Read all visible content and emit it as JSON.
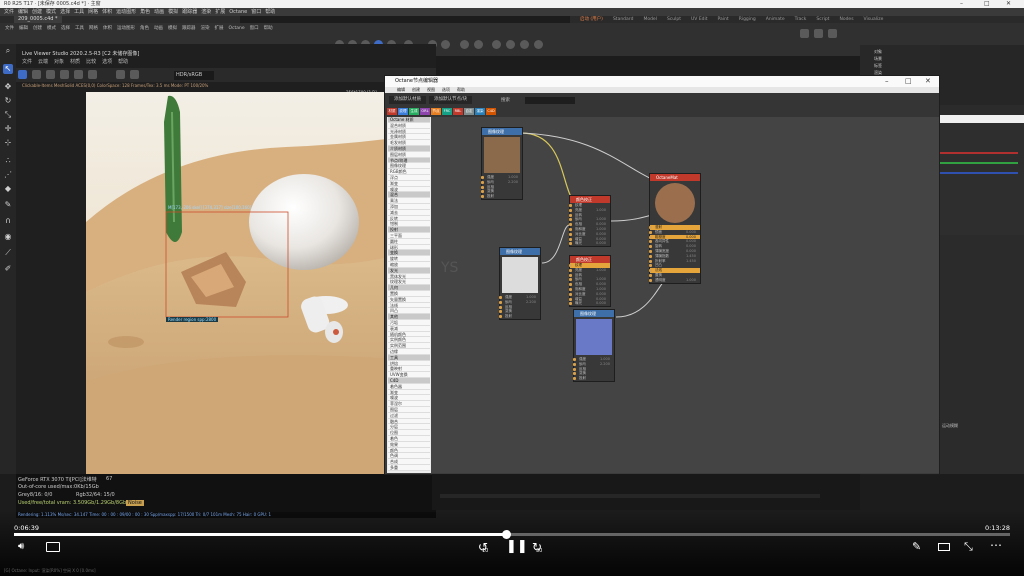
{
  "window": {
    "title": "R0 R25 T17 · [未保存 0005.c4d *] · 主窗",
    "file_tab": "209_0005.c4d *"
  },
  "menubar": [
    "文件",
    "编辑",
    "创建",
    "模式",
    "选择",
    "工具",
    "网格",
    "体积",
    "运动图形",
    "角色",
    "动画",
    "模拟",
    "跟踪器",
    "渲染",
    "扩展",
    "Octane",
    "窗口",
    "帮助"
  ],
  "layouts": [
    {
      "label": "启动 (用户)",
      "active": true
    },
    {
      "label": "Standard"
    },
    {
      "label": "Model"
    },
    {
      "label": "Sculpt"
    },
    {
      "label": "UV Edit"
    },
    {
      "label": "Paint"
    },
    {
      "label": "Rigging"
    },
    {
      "label": "Animate"
    },
    {
      "label": "Track"
    },
    {
      "label": "Script"
    },
    {
      "label": "Nodes"
    },
    {
      "label": "Visualize"
    }
  ],
  "live_viewer": {
    "title": "Live Viewer Studio 2020.2.5-R3   [C2 未储存图像]",
    "menu": [
      "文件",
      "云端",
      "对象",
      "材质",
      "比较",
      "选项",
      "帮助"
    ],
    "resolution": "HDR/sRGB",
    "info": "Clickable-Items  MeshSolid  ACES(0,0) ColorSpace: 128 Frames/Tex: 3.5 ms  Mode:  PT 100/20%",
    "fps_label": "256*1700 [1/2]",
    "region_label": "Render region spp:2800",
    "pick_label": "M[173,-206 skel] [374,317] size[100,160]"
  },
  "render_stats": {
    "gpu": "GeForce RTX 3070 Ti[PCI]法维特",
    "gpu_temp": "67",
    "line2": "Out-of-core used/max:0Kb/15Gb",
    "line3a": "Grey8/16: 0/0",
    "line3b": "Rgb32/64: 15/0",
    "line4": "Used/free/total vram: 3.509Gb/1.29Gb/8Gb",
    "noise": "Noise",
    "progress": "Rendering: 1.113%  Ms/sec: 34.147  Time: 00 : 00 : 09/00 : 00 : 30  Spp/maxspp: 17/1500  Tri: 0/7 101m  Mesh: 75  Hair: 0  GPU: 1"
  },
  "node_editor": {
    "title": "Octane节点编辑器",
    "menu": [
      "编辑",
      "创建",
      "视图",
      "选项",
      "帮助"
    ],
    "buttons": [
      "添加默认材质",
      "添加默认节点/块"
    ],
    "search_label": "搜索",
    "tags": [
      "材质",
      "纹理",
      "生成",
      "ORL",
      "节点",
      "FRC",
      "RBL",
      "自定",
      "渲染",
      "C4D"
    ],
    "node_list": [
      {
        "label": "Octane 材质",
        "hdr": true
      },
      {
        "label": "混合材质"
      },
      {
        "label": "光泽材质"
      },
      {
        "label": "金属材质"
      },
      {
        "label": "毛发材质"
      },
      {
        "label": "介质材质",
        "hdr": true
      },
      {
        "label": "图层材质"
      },
      {
        "label": "节点/纹理",
        "hdr": true
      },
      {
        "label": "图像纹理"
      },
      {
        "label": "RGB颜色"
      },
      {
        "label": "浮点"
      },
      {
        "label": "渐变"
      },
      {
        "label": "噪波"
      },
      {
        "label": "混合",
        "hdr": true
      },
      {
        "label": "乘法"
      },
      {
        "label": "添加"
      },
      {
        "label": "减去"
      },
      {
        "label": "反转"
      },
      {
        "label": "钳制"
      },
      {
        "label": "投射",
        "hdr": true
      },
      {
        "label": "三平面"
      },
      {
        "label": "圆柱"
      },
      {
        "label": "球形"
      },
      {
        "label": "变换",
        "hdr": true
      },
      {
        "label": "旋转"
      },
      {
        "label": "缩放"
      },
      {
        "label": "发光",
        "hdr": true
      },
      {
        "label": "黑体发光"
      },
      {
        "label": "纹理发光"
      },
      {
        "label": "几何",
        "hdr": true
      },
      {
        "label": "置换"
      },
      {
        "label": "矢量置换"
      },
      {
        "label": "法线"
      },
      {
        "label": "凹凸"
      },
      {
        "label": "其他",
        "hdr": true
      },
      {
        "label": "污垢"
      },
      {
        "label": "衰减"
      },
      {
        "label": "随机颜色"
      },
      {
        "label": "实例颜色"
      },
      {
        "label": "实例范围"
      },
      {
        "label": "边缘"
      },
      {
        "label": "工具",
        "hdr": true
      },
      {
        "label": "烘焙"
      },
      {
        "label": "重映射"
      },
      {
        "label": "UVW变换"
      },
      {
        "label": "C4D",
        "hdr": true
      },
      {
        "label": "着色器"
      },
      {
        "label": "渐变"
      },
      {
        "label": "噪波"
      },
      {
        "label": "菲涅尔"
      },
      {
        "label": "图层"
      },
      {
        "label": "过滤"
      },
      {
        "label": "融合"
      },
      {
        "label": "分层"
      },
      {
        "label": "位图"
      },
      {
        "label": "着色"
      },
      {
        "label": "效果"
      },
      {
        "label": "颜色"
      },
      {
        "label": "色调"
      },
      {
        "label": "合成"
      },
      {
        "label": "多重"
      }
    ],
    "nodes": {
      "tex1": {
        "title": "图像纹理",
        "ports": [
          {
            "l": "强度",
            "v": "1.000"
          },
          {
            "l": "伽马",
            "v": "2.200"
          },
          {
            "l": "反相",
            "v": ""
          },
          {
            "l": "变换",
            "v": ""
          },
          {
            "l": "投射",
            "v": ""
          }
        ]
      },
      "mix1": {
        "title": "颜色校正",
        "ports": [
          {
            "l": "纹理",
            "v": ""
          },
          {
            "l": "亮度",
            "v": "1.000"
          },
          {
            "l": "反转",
            "v": ""
          },
          {
            "l": "伽马",
            "v": "1.000"
          },
          {
            "l": "色相",
            "v": "0.000"
          },
          {
            "l": "饱和度",
            "v": "1.000"
          },
          {
            "l": "对比度",
            "v": "0.000"
          },
          {
            "l": "增益",
            "v": "0.000"
          },
          {
            "l": "曝光",
            "v": "0.000"
          }
        ]
      },
      "mix2": {
        "title": "颜色校正",
        "ports": [
          {
            "l": "纹理",
            "v": "",
            "sel": true
          },
          {
            "l": "亮度",
            "v": "1.000"
          },
          {
            "l": "反转",
            "v": ""
          },
          {
            "l": "伽马",
            "v": "1.000"
          },
          {
            "l": "色相",
            "v": "0.000"
          },
          {
            "l": "饱和度",
            "v": "1.000"
          },
          {
            "l": "对比度",
            "v": "0.000"
          },
          {
            "l": "增益",
            "v": "0.000"
          },
          {
            "l": "曝光",
            "v": "0.000"
          }
        ]
      },
      "tex2": {
        "title": "图像纹理",
        "ports": [
          {
            "l": "强度",
            "v": "1.000"
          },
          {
            "l": "伽马",
            "v": "2.200"
          },
          {
            "l": "反相",
            "v": ""
          },
          {
            "l": "变换",
            "v": ""
          },
          {
            "l": "投射",
            "v": ""
          }
        ]
      },
      "tex3": {
        "title": "图像纹理",
        "ports": [
          {
            "l": "强度",
            "v": "1.000"
          },
          {
            "l": "伽马",
            "v": "2.200"
          },
          {
            "l": "反相",
            "v": ""
          },
          {
            "l": "变换",
            "v": ""
          },
          {
            "l": "投射",
            "v": ""
          }
        ]
      },
      "mat": {
        "title": "OctaneMat",
        "ports": [
          {
            "l": "漫射",
            "v": "",
            "sel": true
          },
          {
            "l": "镜面",
            "v": "0.000"
          },
          {
            "l": "粗糙度",
            "v": "0.000",
            "sel": true
          },
          {
            "l": "各向异性",
            "v": "0.000"
          },
          {
            "l": "旋转",
            "v": "0.000"
          },
          {
            "l": "薄膜宽度",
            "v": "0.000"
          },
          {
            "l": "薄膜指数",
            "v": "1.450"
          },
          {
            "l": "折射率",
            "v": "1.450"
          },
          {
            "l": "凹凸",
            "v": ""
          },
          {
            "l": "法线",
            "v": "",
            "sel": true
          },
          {
            "l": "置换",
            "v": ""
          },
          {
            "l": "透明度",
            "v": "1.000"
          }
        ]
      }
    }
  },
  "right_panel": {
    "objects": [
      "对象",
      "场景",
      "标签",
      "渲染",
      "材质",
      "摄像机",
      "灯光",
      "Octane"
    ],
    "attr_label": "运动模糊"
  },
  "player": {
    "current": "0:06:39",
    "duration": "0:13:28",
    "progress": 0.494,
    "skip_back": "10",
    "skip_fwd": "30"
  },
  "statusbar": "[G] Octane: Input: 渲染[R0%] 空闲 X 0 [0.0ms]",
  "colors": {
    "accent": "#3d6bc5",
    "orange": "#e6824b",
    "node_header": "#3e6fa8",
    "mat_header": "#c0392b"
  }
}
